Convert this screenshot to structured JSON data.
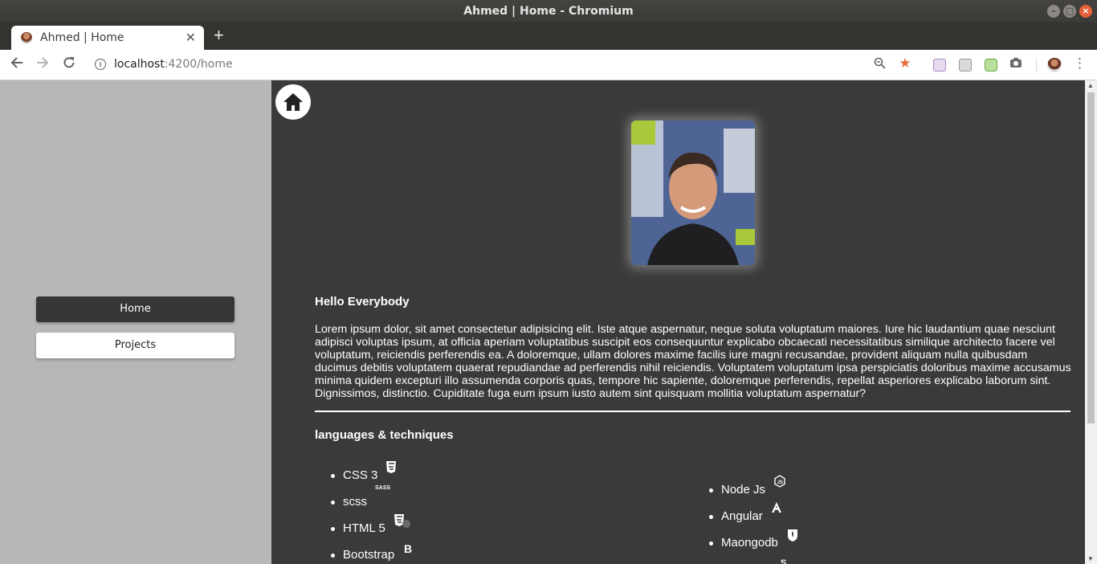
{
  "window": {
    "title": "Ahmed | Home - Chromium"
  },
  "tab": {
    "title": "Ahmed | Home"
  },
  "address": {
    "host": "localhost",
    "path": ":4200/home"
  },
  "sidebar": {
    "items": [
      {
        "label": "Home",
        "active": true
      },
      {
        "label": "Projects",
        "active": false
      }
    ]
  },
  "main": {
    "greeting": "Hello Everybody",
    "bio": "Lorem ipsum dolor, sit amet consectetur adipisicing elit. Iste atque aspernatur, neque soluta voluptatum maiores. Iure hic laudantium quae nesciunt adipisci voluptas ipsum, at officia aperiam voluptatibus suscipit eos consequuntur explicabo obcaecati necessitatibus similique architecto facere vel voluptatum, reiciendis perferendis ea. A doloremque, ullam dolores maxime facilis iure magni recusandae, provident aliquam nulla quibusdam ducimus debitis voluptatem quaerat repudiandae ad perferendis nihil reiciendis. Voluptatem voluptatum ipsa perspiciatis doloribus maxime accusamus minima quidem excepturi illo assumenda corporis quas, tempore hic sapiente, doloremque perferendis, repellat asperiores explicabo laborum sint. Dignissimos, distinctio. Cupiditate fuga eum ipsum iusto autem sint quisquam mollitia voluptatum aspernatur?",
    "skills_title": "languages & techniques",
    "skills_left": [
      {
        "label": "CSS 3",
        "icon": "css3-icon"
      },
      {
        "label": "scss",
        "icon": "sass-icon",
        "icon_text": "SASS"
      },
      {
        "label": "HTML 5",
        "icon": "html5-icon"
      },
      {
        "label": "Bootstrap",
        "icon": "bootstrap-icon"
      }
    ],
    "skills_right": [
      {
        "label": "Node Js",
        "icon": "nodejs-icon"
      },
      {
        "label": "Angular",
        "icon": "angular-icon"
      },
      {
        "label": "Maongodb",
        "icon": "mongodb-icon"
      }
    ]
  },
  "colors": {
    "sidebar_bg": "#b7b7b7",
    "content_bg": "#3a3a3a",
    "active_nav": "#363636",
    "bookmark_star": "#e8713a"
  }
}
